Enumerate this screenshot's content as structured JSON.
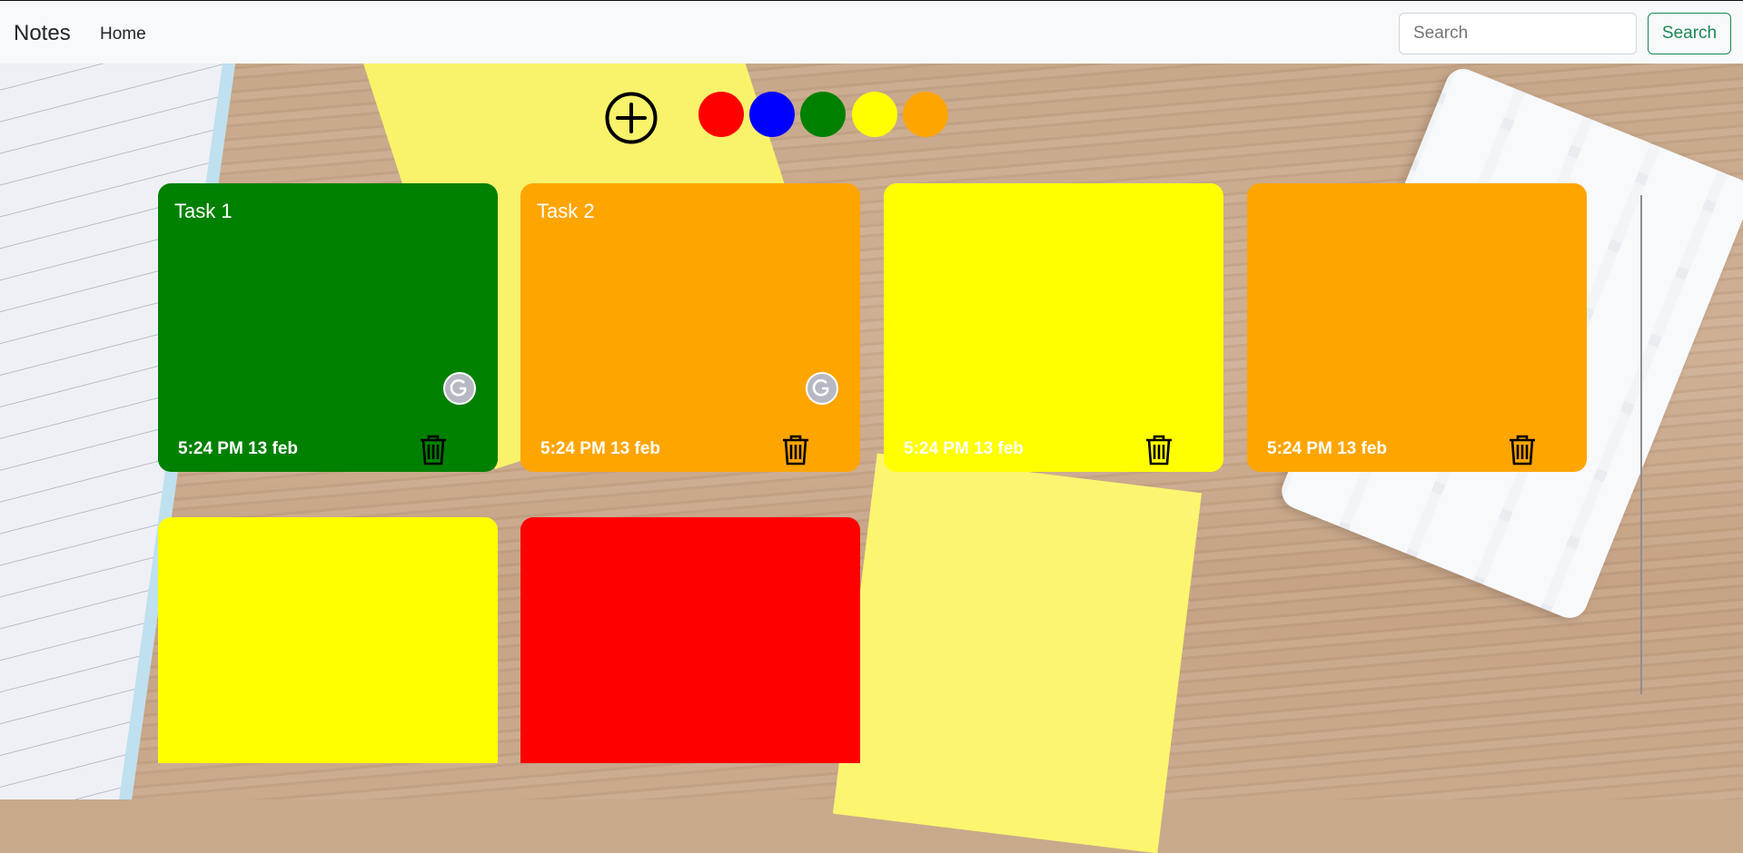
{
  "navbar": {
    "brand": "Notes",
    "home": "Home",
    "search_placeholder": "Search",
    "search_button": "Search"
  },
  "toolbar": {
    "add_icon": "plus-circle-icon",
    "colors": [
      "#ff0000",
      "#0000ff",
      "#008000",
      "#ffff00",
      "#ffa500"
    ]
  },
  "notes": [
    {
      "title": "Task 1",
      "time": "5:24 PM 13 feb",
      "color": "#008000"
    },
    {
      "title": "Task 2",
      "time": "5:24 PM 13 feb",
      "color": "#ffa500"
    },
    {
      "title": "",
      "time": "5:24 PM 13 feb",
      "color": "#ffff00"
    },
    {
      "title": "",
      "time": "5:24 PM 13 feb",
      "color": "#ffa500"
    },
    {
      "title": "",
      "time": "",
      "color": "#ffff00"
    },
    {
      "title": "",
      "time": "",
      "color": "#ff0000"
    }
  ]
}
